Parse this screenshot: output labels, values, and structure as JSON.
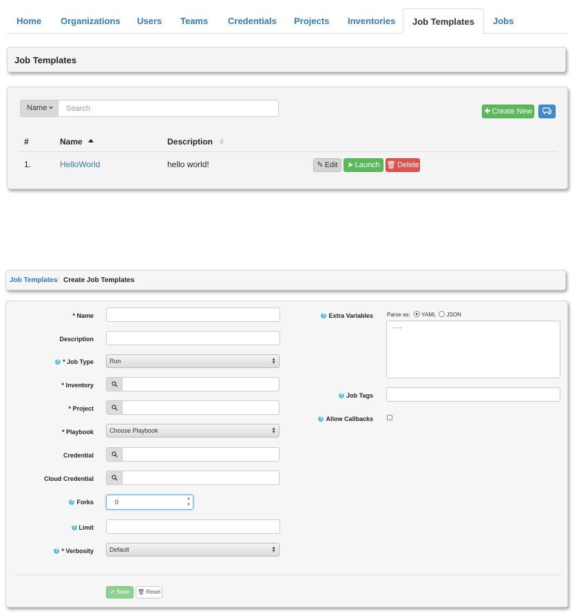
{
  "nav": {
    "tabs": [
      {
        "label": "Home"
      },
      {
        "label": "Organizations"
      },
      {
        "label": "Users"
      },
      {
        "label": "Teams"
      },
      {
        "label": "Credentials"
      },
      {
        "label": "Projects"
      },
      {
        "label": "Inventories"
      },
      {
        "label": "Job Templates",
        "active": true
      },
      {
        "label": "Jobs"
      }
    ]
  },
  "list_page": {
    "title": "Job Templates",
    "search": {
      "field": "Name",
      "placeholder": "Search"
    },
    "create_button": "Create New",
    "create_icon": "plus-icon",
    "chat_icon": "comments-icon",
    "columns": [
      "#",
      "Name",
      "Description"
    ],
    "rows": [
      {
        "index": "1.",
        "name": "HelloWorld",
        "description": "hello world!"
      }
    ],
    "row_actions": {
      "edit": "Edit",
      "launch": "Launch",
      "delete": "Delete"
    }
  },
  "form_page": {
    "breadcrumb": {
      "parent": "Job Templates",
      "separator": "/",
      "current": "Create Job Templates"
    },
    "labels": {
      "name": "* Name",
      "description": "Description",
      "job_type": "* Job Type",
      "inventory": "* Inventory",
      "project": "* Project",
      "playbook": "* Playbook",
      "credential": "Credential",
      "cloud_credential": "Cloud Credential",
      "forks": "Forks",
      "limit": "Limit",
      "verbosity": "* Verbosity",
      "extra_variables": "Extra Variables",
      "job_tags": "Job Tags",
      "allow_callbacks": "Allow Callbacks"
    },
    "values": {
      "job_type": "Run",
      "playbook": "Choose Playbook",
      "forks": "0",
      "verbosity": "Default",
      "extra_variables": "---"
    },
    "parse_as": {
      "label": "Parse as:",
      "options": [
        "YAML",
        "JSON"
      ],
      "selected": "YAML"
    },
    "buttons": {
      "save": "Save",
      "reset": "Reset"
    }
  },
  "colors": {
    "link": "#337ab7",
    "success": "#5cb85c",
    "primary": "#428bca",
    "danger": "#d9534f",
    "help": "#5bc0de"
  }
}
